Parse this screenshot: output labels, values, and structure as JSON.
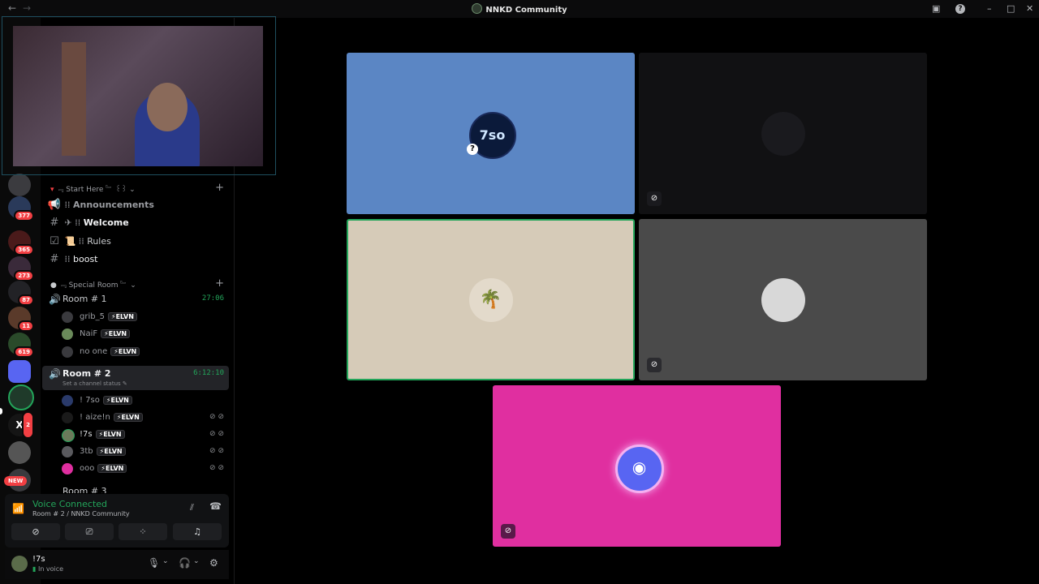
{
  "window": {
    "title": "NNKD Community",
    "back": "←",
    "forward": "→"
  },
  "servers": [
    {
      "badge": ""
    },
    {
      "badge": "377"
    },
    {
      "badge": "365"
    },
    {
      "badge": "273"
    },
    {
      "badge": "87"
    },
    {
      "badge": "11"
    },
    {
      "badge": "619"
    },
    {
      "badge": ""
    },
    {
      "badge": ""
    },
    {
      "badge": "2"
    },
    {
      "badge": ""
    },
    {
      "badge": "NEW"
    }
  ],
  "categories": {
    "start_here": "﹃ Start Here ﹄ ꒰꒱",
    "special_room": "﹃ Special Room ﹄"
  },
  "channels": [
    {
      "name": "Announcements",
      "prefix": "⁞⁞"
    },
    {
      "name": "Welcome",
      "prefix": "✈ ⁞⁞"
    },
    {
      "name": "Rules",
      "prefix": "📜 ⁞⁞"
    },
    {
      "name": "boost",
      "prefix": "⁞⁞"
    }
  ],
  "rooms": [
    {
      "name": "Room # 1",
      "time": "27:06"
    },
    {
      "name": "Room # 2",
      "time": "6:12:10",
      "status": "Set a channel status"
    },
    {
      "name": "Room # 3"
    }
  ],
  "room1_users": [
    {
      "name": "grib_5",
      "tag": "ELVN"
    },
    {
      "name": "NaiF",
      "tag": "ELVN"
    },
    {
      "name": "no one",
      "tag": "ELVN"
    }
  ],
  "room2_users": [
    {
      "name": "! 7so",
      "tag": "ELVN"
    },
    {
      "name": "! aize!n",
      "tag": "ELVN"
    },
    {
      "name": "!7s",
      "tag": "ELVN"
    },
    {
      "name": "3tb",
      "tag": "ELVN"
    },
    {
      "name": "ooo",
      "tag": "ELVN"
    }
  ],
  "voice": {
    "status": "Voice Connected",
    "location": "Room # 2 / NNKD Community"
  },
  "user": {
    "name": "!7s",
    "status": "In voice"
  },
  "tiles": [
    {
      "bg": "#5b86c4",
      "avatar": "7so"
    },
    {
      "bg": "#111113",
      "avatar": ""
    },
    {
      "bg": "#d6cbb8",
      "avatar": ""
    },
    {
      "bg": "#4a4a4a",
      "avatar": ""
    },
    {
      "bg": "#e02fa0",
      "avatar": "discord"
    }
  ],
  "colors": {
    "accent": "#23a55a",
    "discord_blurple": "#5865f2",
    "badge_red": "#f23f43"
  }
}
